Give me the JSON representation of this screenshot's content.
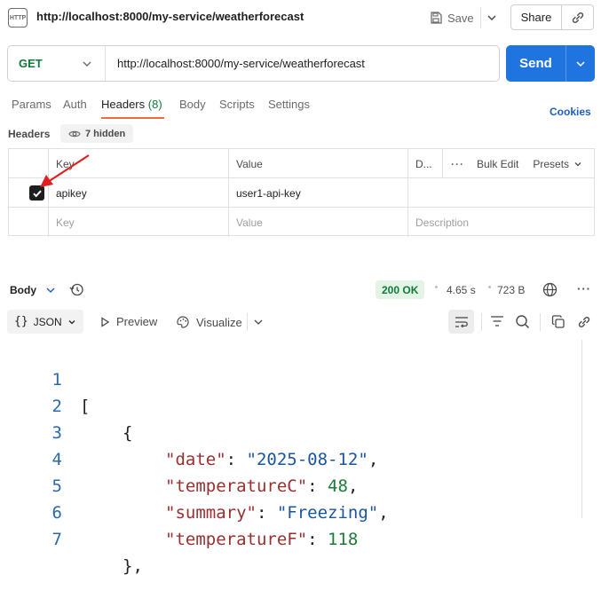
{
  "topbar": {
    "badge": "HTTP",
    "title": "http://localhost:8000/my-service/weatherforecast",
    "save_label": "Save",
    "share_label": "Share"
  },
  "request": {
    "method": "GET",
    "url": "http://localhost:8000/my-service/weatherforecast",
    "send_label": "Send"
  },
  "tabs": {
    "params": "Params",
    "auth": "Auth",
    "headers": "Headers",
    "headers_count": "(8)",
    "body": "Body",
    "scripts": "Scripts",
    "settings": "Settings",
    "cookies": "Cookies"
  },
  "headers_section": {
    "label": "Headers",
    "hidden": "7 hidden"
  },
  "table": {
    "col_key": "Key",
    "col_value": "Value",
    "col_desc": "D...",
    "bulk_edit": "Bulk Edit",
    "presets": "Presets",
    "rows": [
      {
        "key": "apikey",
        "value": "user1-api-key"
      }
    ],
    "placeholder_key": "Key",
    "placeholder_value": "Value",
    "placeholder_desc": "Description"
  },
  "response": {
    "body_label": "Body",
    "status": "200 OK",
    "time": "4.65 s",
    "size": "723 B"
  },
  "viewbar": {
    "format": "JSON",
    "preview": "Preview",
    "visualize": "Visualize"
  },
  "code": {
    "line_numbers": [
      "1",
      "2",
      "3",
      "4",
      "5",
      "6",
      "7"
    ],
    "open_bracket": "[",
    "open_brace": "{",
    "close_brace": "},",
    "date_key": "\"date\"",
    "date_val": "\"2025-08-12\"",
    "tc_key": "\"temperatureC\"",
    "tc_val": "48",
    "summary_key": "\"summary\"",
    "summary_val": "\"Freezing\"",
    "tf_key": "\"temperatureF\"",
    "tf_val": "118"
  },
  "colors": {
    "accent": "#1f74e0",
    "tab_underline": "#f26b3a",
    "success": "#0f7a3a",
    "annotation_arrow": "#e02020"
  }
}
